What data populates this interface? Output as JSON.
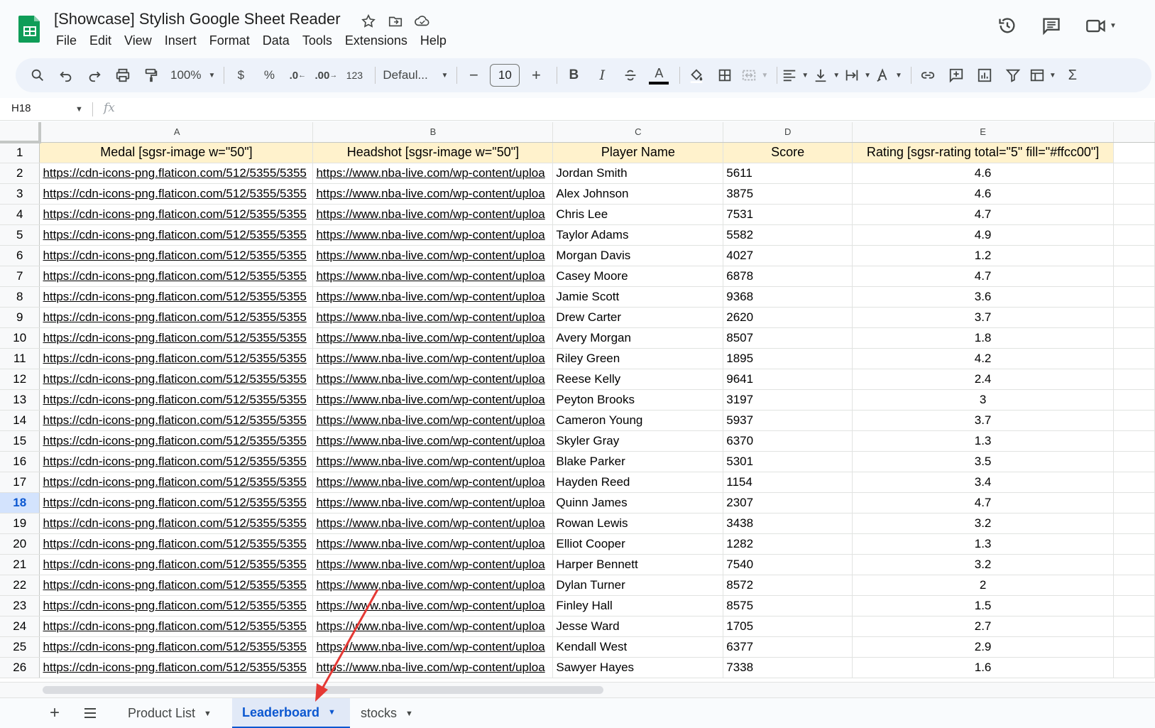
{
  "app": {
    "title": "[Showcase] Stylish Google Sheet Reader",
    "menu": [
      "File",
      "Edit",
      "View",
      "Insert",
      "Format",
      "Data",
      "Tools",
      "Extensions",
      "Help"
    ]
  },
  "toolbar": {
    "zoom": "100%",
    "currency": "$",
    "percent": "%",
    "dec_decrease": ".0",
    "dec_increase": ".00",
    "number_format": "123",
    "font": "Defaul...",
    "font_size": "10",
    "minus": "−",
    "plus": "+",
    "bold": "B",
    "italic": "I",
    "text_color": "A",
    "sum": "Σ"
  },
  "formula_bar": {
    "cell_ref": "H18",
    "fx": "fx"
  },
  "grid": {
    "columns": [
      "A",
      "B",
      "C",
      "D",
      "E"
    ],
    "header": [
      "Medal [sgsr-image w=\"50\"]",
      "Headshot [sgsr-image w=\"50\"]",
      "Player Name",
      "Score",
      "Rating [sgsr-rating  total=\"5\" fill=\"#ffcc00\"]"
    ],
    "medal_url": "https://cdn-icons-png.flaticon.com/512/5355/5355",
    "headshot_url": "https://www.nba-live.com/wp-content/uploa",
    "selected_row": "18",
    "rows": [
      {
        "n": "2",
        "name": "Jordan Smith",
        "score": "5611",
        "rating": "4.6"
      },
      {
        "n": "3",
        "name": "Alex Johnson",
        "score": "3875",
        "rating": "4.6"
      },
      {
        "n": "4",
        "name": "Chris Lee",
        "score": "7531",
        "rating": "4.7"
      },
      {
        "n": "5",
        "name": "Taylor Adams",
        "score": "5582",
        "rating": "4.9"
      },
      {
        "n": "6",
        "name": "Morgan Davis",
        "score": "4027",
        "rating": "1.2"
      },
      {
        "n": "7",
        "name": "Casey Moore",
        "score": "6878",
        "rating": "4.7"
      },
      {
        "n": "8",
        "name": "Jamie Scott",
        "score": "9368",
        "rating": "3.6"
      },
      {
        "n": "9",
        "name": "Drew Carter",
        "score": "2620",
        "rating": "3.7"
      },
      {
        "n": "10",
        "name": "Avery Morgan",
        "score": "8507",
        "rating": "1.8"
      },
      {
        "n": "11",
        "name": "Riley Green",
        "score": "1895",
        "rating": "4.2"
      },
      {
        "n": "12",
        "name": "Reese Kelly",
        "score": "9641",
        "rating": "2.4"
      },
      {
        "n": "13",
        "name": "Peyton Brooks",
        "score": "3197",
        "rating": "3"
      },
      {
        "n": "14",
        "name": "Cameron Young",
        "score": "5937",
        "rating": "3.7"
      },
      {
        "n": "15",
        "name": "Skyler Gray",
        "score": "6370",
        "rating": "1.3"
      },
      {
        "n": "16",
        "name": "Blake Parker",
        "score": "5301",
        "rating": "3.5"
      },
      {
        "n": "17",
        "name": "Hayden Reed",
        "score": "1154",
        "rating": "3.4"
      },
      {
        "n": "18",
        "name": "Quinn James",
        "score": "2307",
        "rating": "4.7"
      },
      {
        "n": "19",
        "name": "Rowan Lewis",
        "score": "3438",
        "rating": "3.2"
      },
      {
        "n": "20",
        "name": "Elliot Cooper",
        "score": "1282",
        "rating": "1.3"
      },
      {
        "n": "21",
        "name": "Harper Bennett",
        "score": "7540",
        "rating": "3.2"
      },
      {
        "n": "22",
        "name": "Dylan Turner",
        "score": "8572",
        "rating": "2"
      },
      {
        "n": "23",
        "name": "Finley Hall",
        "score": "8575",
        "rating": "1.5"
      },
      {
        "n": "24",
        "name": "Jesse Ward",
        "score": "1705",
        "rating": "2.7"
      },
      {
        "n": "25",
        "name": "Kendall West",
        "score": "6377",
        "rating": "2.9"
      },
      {
        "n": "26",
        "name": "Sawyer Hayes",
        "score": "7338",
        "rating": "1.6"
      }
    ]
  },
  "sheets": {
    "tabs": [
      "Product List",
      "Leaderboard",
      "stocks"
    ],
    "active": "Leaderboard"
  },
  "colors": {
    "header_fill": "#fff2cc",
    "accent": "#0b57d0",
    "arrow": "#e53935",
    "logo": "#0f9d58"
  },
  "icons": [
    "search-icon",
    "undo-icon",
    "redo-icon",
    "print-icon",
    "paint-format-icon",
    "strikethrough-icon",
    "fill-color-icon",
    "borders-icon",
    "merge-icon",
    "align-icon",
    "valign-icon",
    "wrap-icon",
    "rotate-icon",
    "link-icon",
    "comment-icon",
    "chart-icon",
    "filter-icon",
    "view-icon",
    "history-icon",
    "chat-icon",
    "meet-icon",
    "star-icon",
    "folder-icon",
    "cloud-icon"
  ]
}
